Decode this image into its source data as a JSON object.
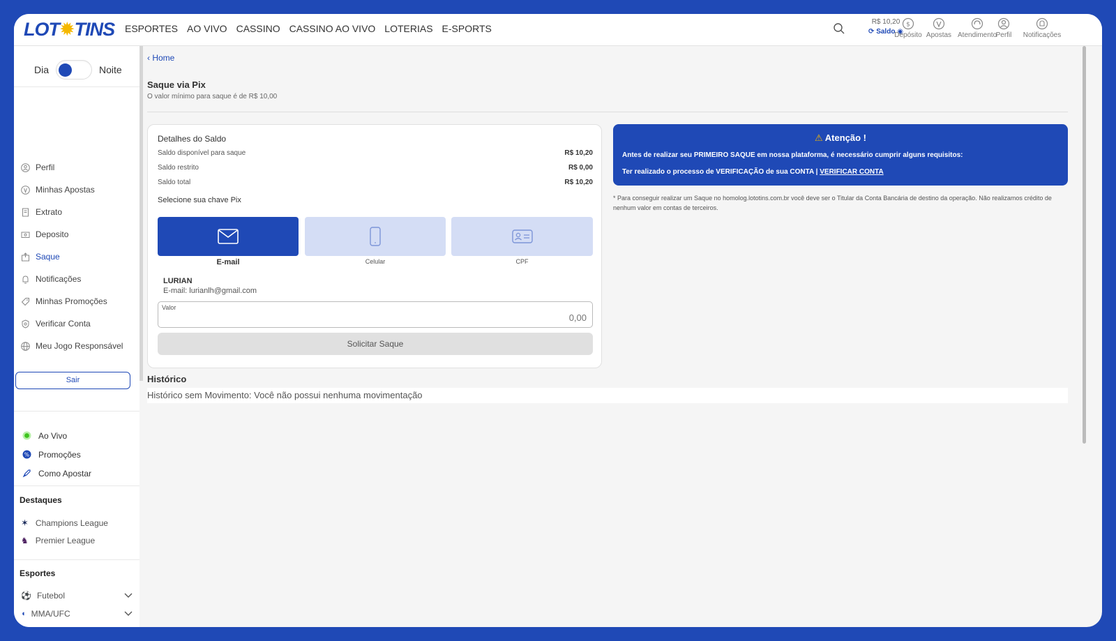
{
  "header": {
    "logo_left": "LOT",
    "logo_right": "TINS",
    "nav": [
      "ESPORTES",
      "AO VIVO",
      "CASSINO",
      "CASSINO AO VIVO",
      "LOTERIAS",
      "E-SPORTS"
    ],
    "balance_value": "R$ 10,20",
    "balance_label": "Saldo",
    "icons": {
      "deposito": "Depósito",
      "apostas": "Apostas",
      "atendimento": "Atendimento",
      "perfil": "Perfil",
      "notificacoes": "Notificações"
    }
  },
  "sidebar": {
    "theme_day": "Dia",
    "theme_night": "Noite",
    "menu": [
      {
        "label": "Perfil",
        "icon": "user-icon"
      },
      {
        "label": "Minhas Apostas",
        "icon": "bets-icon"
      },
      {
        "label": "Extrato",
        "icon": "receipt-icon"
      },
      {
        "label": "Deposito",
        "icon": "wallet-icon"
      },
      {
        "label": "Saque",
        "icon": "withdraw-icon"
      },
      {
        "label": "Notificações",
        "icon": "bell-icon"
      },
      {
        "label": "Minhas Promoções",
        "icon": "tag-icon"
      },
      {
        "label": "Verificar Conta",
        "icon": "shield-icon"
      },
      {
        "label": "Meu Jogo Responsável",
        "icon": "globe-icon"
      }
    ],
    "logout": "Sair",
    "links": [
      "Ao Vivo",
      "Promoções",
      "Como Apostar"
    ],
    "highlights_title": "Destaques",
    "highlights": [
      "Champions League",
      "Premier League"
    ],
    "sports_title": "Esportes",
    "sports": [
      "Futebol",
      "MMA/UFC"
    ]
  },
  "main": {
    "breadcrumb": "Home",
    "title": "Saque via Pix",
    "subtitle": "O valor mínimo para saque é de R$ 10,00",
    "balance": {
      "title": "Detalhes do Saldo",
      "rows": [
        {
          "label": "Saldo disponível para saque",
          "value": "R$ 10,20"
        },
        {
          "label": "Saldo restrito",
          "value": "R$ 0,00"
        },
        {
          "label": "Saldo total",
          "value": "R$ 10,20"
        }
      ]
    },
    "pix_label": "Selecione sua chave Pix",
    "pix_options": [
      "E-mail",
      "Celular",
      "CPF"
    ],
    "user_name": "LURIAN",
    "user_email": "E-mail: lurianlh@gmail.com",
    "valor_label": "Valor",
    "valor_placeholder": "0,00",
    "submit": "Solicitar Saque",
    "history_title": "Histórico",
    "history_empty": "Histórico sem Movimento: Você não possui nenhuma movimentação",
    "alert": {
      "title": "Atenção !",
      "line1": "Antes de realizar seu PRIMEIRO SAQUE em nossa plataforma, é necessário cumprir alguns requisitos:",
      "line2": "Ter realizado o processo de VERIFICAÇÃO de sua CONTA | ",
      "link": "VERIFICAR CONTA"
    },
    "note": "* Para conseguir realizar um Saque no homolog.lototins.com.br você deve ser o Titular da Conta Bancária de destino da operação. Não realizamos crédito de nenhum valor em contas de terceiros."
  },
  "colors": {
    "brand": "#1f49b6",
    "accent": "#f5b800",
    "pix_inactive": "#d4ddf5"
  }
}
